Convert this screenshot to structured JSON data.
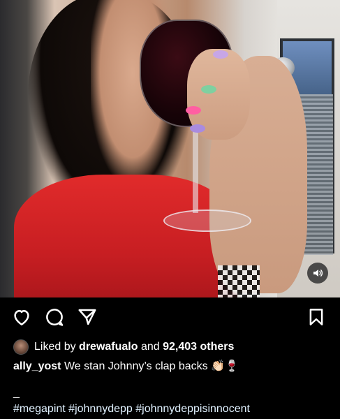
{
  "post": {
    "liked_by_prefix": "Liked by",
    "liked_by_user": "drewafualo",
    "liked_by_and": "and",
    "likes_count": "92,403 others",
    "caption_user": "ally_yost",
    "caption_text": "We stan Johnny’s clap backs 👏🏻🍷",
    "separator": "_",
    "hashtags": "#megapint #johnnydepp #johnnydeppisinnocent"
  },
  "icons": {
    "like": "heart-icon",
    "comment": "comment-icon",
    "share": "paper-plane-icon",
    "save": "bookmark-icon",
    "sound": "speaker-icon"
  },
  "colors": {
    "background": "#000000",
    "text": "#ffffff",
    "hashtag": "#e0f1ff"
  }
}
